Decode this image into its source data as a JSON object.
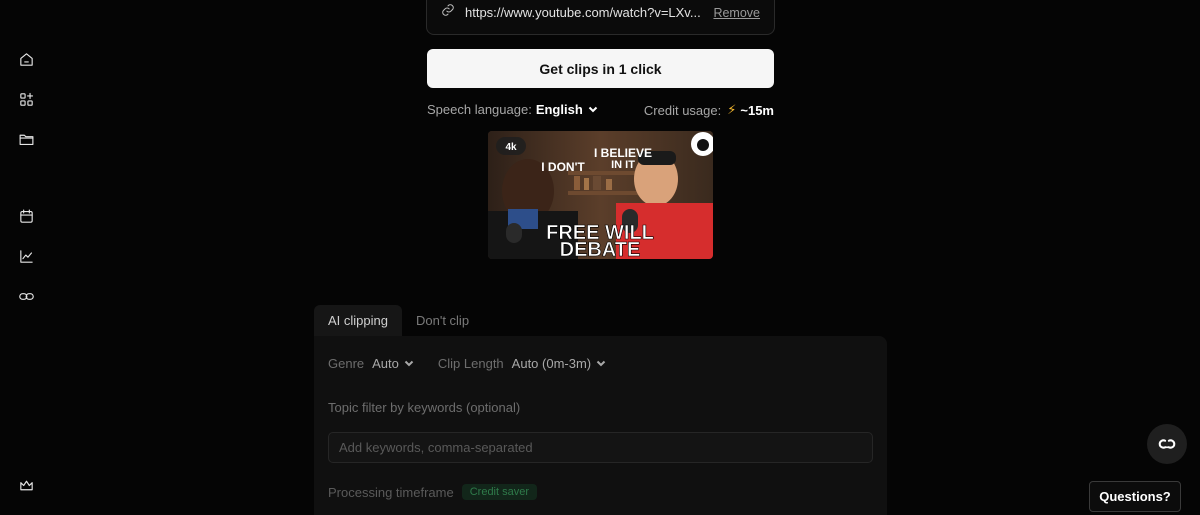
{
  "sidebar": {
    "items": [
      {
        "name": "home-icon"
      },
      {
        "name": "add-apps-icon"
      },
      {
        "name": "folder-icon"
      },
      {
        "name": "calendar-icon"
      },
      {
        "name": "analytics-icon"
      },
      {
        "name": "link-icon"
      },
      {
        "name": "crown-icon"
      }
    ]
  },
  "source": {
    "url": "https://www.youtube.com/watch?v=LXv...",
    "remove_label": "Remove"
  },
  "primary_action": {
    "label": "Get clips in 1 click"
  },
  "speech": {
    "label": "Speech language:",
    "value": "English"
  },
  "credit": {
    "label": "Credit usage:",
    "value": "~15m",
    "icon": "lightning-icon",
    "icon_color": "#f5b82e"
  },
  "thumbnail": {
    "badge": "4k",
    "bubble_left": "I DON'T",
    "bubble_right_line1": "I BELIEVE",
    "bubble_right_line2": "IN IT",
    "title_line1": "FREE WILL",
    "title_line2": "DEBATE"
  },
  "panel": {
    "tabs": [
      {
        "label": "AI clipping",
        "active": true
      },
      {
        "label": "Don't clip",
        "active": false
      }
    ],
    "genre": {
      "label": "Genre",
      "value": "Auto"
    },
    "clip_length": {
      "label": "Clip Length",
      "value": "Auto (0m-3m)"
    },
    "topic_label": "Topic filter by keywords (optional)",
    "keywords_placeholder": "Add keywords, comma-separated",
    "timeframe_label": "Processing timeframe",
    "timeframe_badge": "Credit saver"
  },
  "help": {
    "questions_label": "Questions?"
  }
}
